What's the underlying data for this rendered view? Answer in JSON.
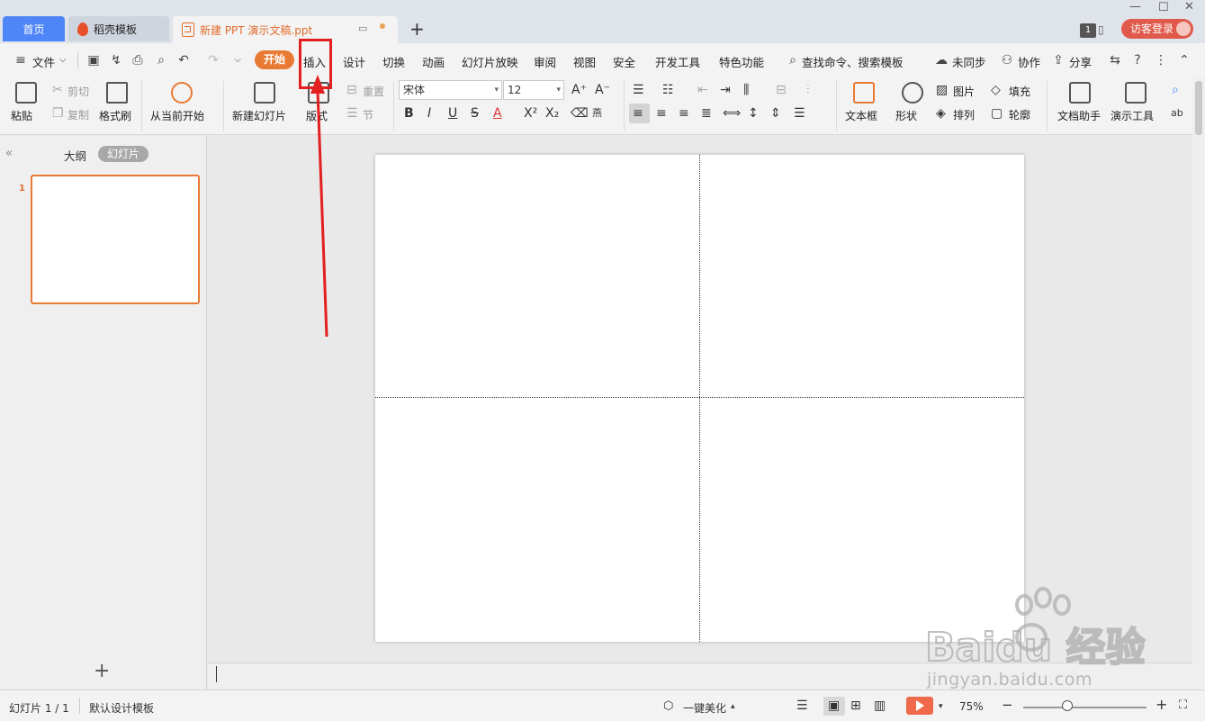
{
  "tabs": {
    "home": "首页",
    "template": "稻壳模板",
    "document": "新建 PPT 演示文稿.ppt",
    "window_count": "1",
    "login": "访客登录"
  },
  "menu": {
    "file": "文件",
    "start": "开始",
    "insert": "插入",
    "design": "设计",
    "transition": "切换",
    "animation": "动画",
    "slideshow": "幻灯片放映",
    "review": "审阅",
    "view": "视图",
    "security": "安全",
    "devtools": "开发工具",
    "features": "特色功能",
    "search": "查找命令、搜索模板",
    "sync": "未同步",
    "collab": "协作",
    "share": "分享"
  },
  "ribbon": {
    "paste": "粘贴",
    "cut": "剪切",
    "copy": "复制",
    "format_painter": "格式刷",
    "from_current": "从当前开始",
    "new_slide": "新建幻灯片",
    "layout": "版式",
    "reset": "重置",
    "section": "节",
    "font_name": "宋体",
    "font_size": "12",
    "textbox": "文本框",
    "shape": "形状",
    "picture": "图片",
    "arrange": "排列",
    "fill": "填充",
    "outline": "轮廓",
    "doc_assistant": "文档助手",
    "present_tools": "演示工具"
  },
  "left_panel": {
    "outline_tab": "大纲",
    "slides_tab": "幻灯片",
    "slide_number": "1"
  },
  "status": {
    "slide_info": "幻灯片 1 / 1",
    "template": "默认设计模板",
    "beautify": "一键美化",
    "zoom": "75%"
  },
  "watermark": {
    "brand": "Baidu 经验",
    "url": "jingyan.baidu.com"
  },
  "colors": {
    "accent": "#e87a34",
    "home_tab": "#4f86f7",
    "annotation": "#e31f1f",
    "login": "#e05a4c"
  }
}
